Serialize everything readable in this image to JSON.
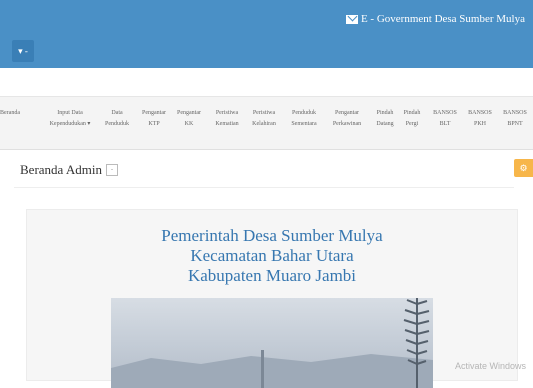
{
  "header": {
    "brand_title": "E - Government Desa Sumber Mulya",
    "menu_toggle": "▾ -"
  },
  "nav": {
    "items": [
      {
        "line1": "Beranda",
        "line2": ""
      },
      {
        "line1": "Input Data",
        "line2": "Kependudukan ▾"
      },
      {
        "line1": "Data",
        "line2": "Penduduk"
      },
      {
        "line1": "Pengantar",
        "line2": "KTP"
      },
      {
        "line1": "Pengantar",
        "line2": "KK"
      },
      {
        "line1": "Peristiwa",
        "line2": "Kematian"
      },
      {
        "line1": "Peristiwa",
        "line2": "Kelahiran"
      },
      {
        "line1": "Penduduk",
        "line2": "Sementara"
      },
      {
        "line1": "Pengantar",
        "line2": "Perkawinan"
      },
      {
        "line1": "Pindah",
        "line2": "Datang"
      },
      {
        "line1": "Pindah",
        "line2": "Pergi"
      },
      {
        "line1": "BANSOS",
        "line2": "BLT"
      },
      {
        "line1": "BANSOS",
        "line2": "PKH"
      },
      {
        "line1": "BANSOS",
        "line2": "BPNT"
      }
    ]
  },
  "page": {
    "title": "Beranda Admin",
    "collapse_btn": "-",
    "settings_icon": "⚙"
  },
  "card": {
    "line1": "Pemerintah Desa Sumber Mulya",
    "line2": "Kecamatan Bahar Utara",
    "line3": "Kabupaten Muaro Jambi"
  },
  "os": {
    "watermark": "Activate Windows"
  }
}
